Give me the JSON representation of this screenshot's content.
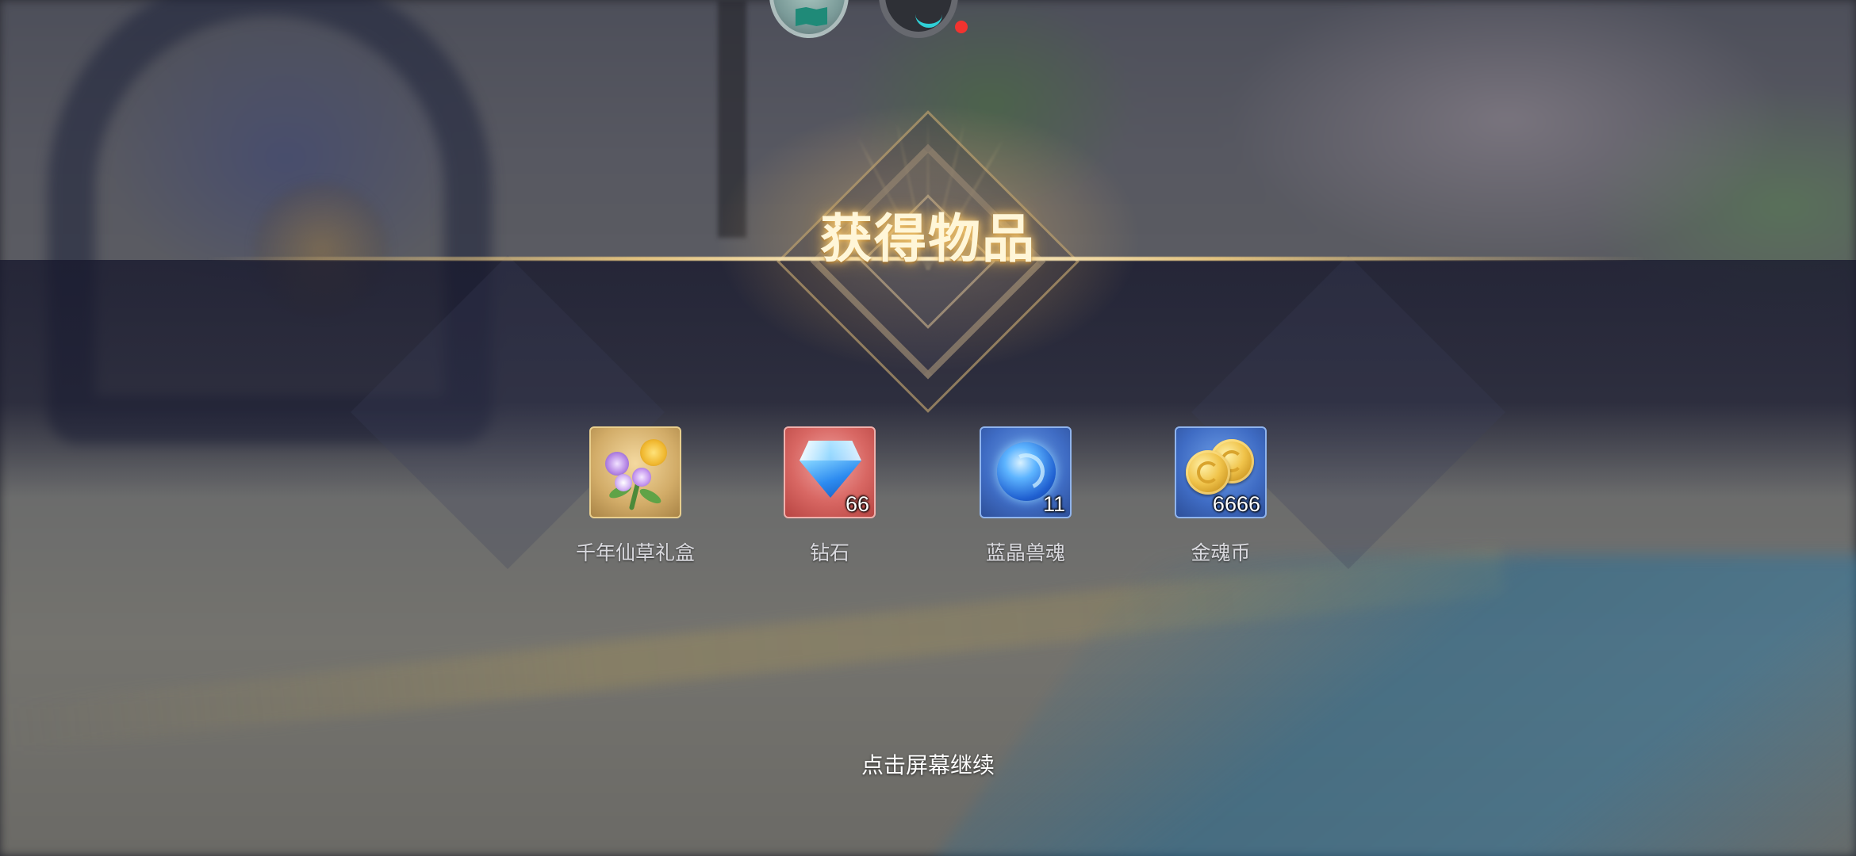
{
  "title": "获得物品",
  "rewards": [
    {
      "name": "千年仙草礼盒",
      "count": "",
      "icon": "herb-gift-box-icon",
      "rarity_color": "#d2ac68"
    },
    {
      "name": "钻石",
      "count": "66",
      "icon": "diamond-icon",
      "rarity_color": "#d86763"
    },
    {
      "name": "蓝晶兽魂",
      "count": "11",
      "icon": "blue-crystal-beast-soul-icon",
      "rarity_color": "#3f6cc4"
    },
    {
      "name": "金魂币",
      "count": "6666",
      "icon": "gold-soul-coin-icon",
      "rarity_color": "#3f6cc4"
    }
  ],
  "hud": {
    "map_icon": "map-icon",
    "timer_icon": "timer-icon",
    "notification_dot_color": "#f2332f"
  },
  "prompt": "点击屏幕继续",
  "accent_gold": "#f0cd82"
}
